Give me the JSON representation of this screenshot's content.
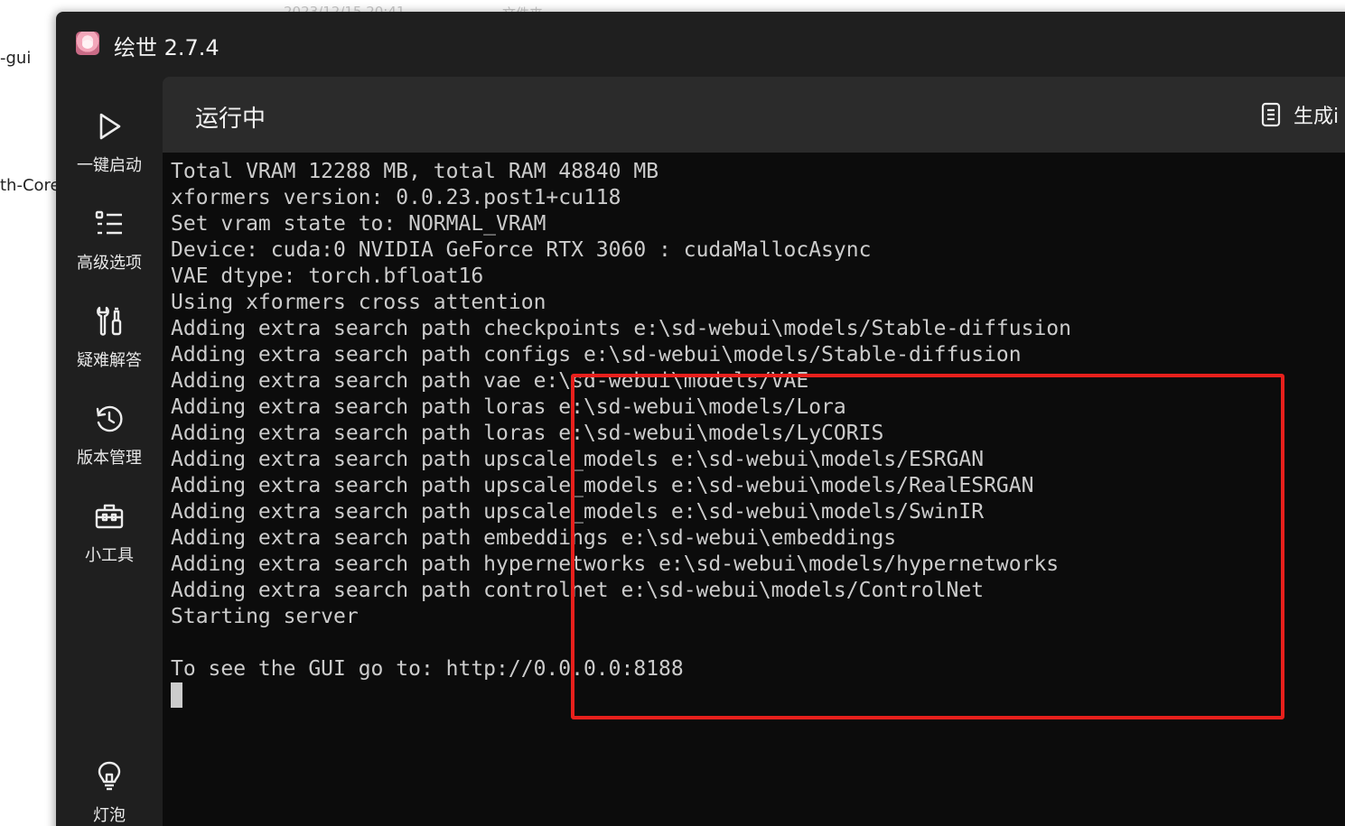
{
  "desktop": {
    "left_text_1": "-gui",
    "left_text_2": "th-Core",
    "top_text_1": "2023/12/15 20:41",
    "top_text_2": "文件夹"
  },
  "window": {
    "title": "绘世 2.7.4"
  },
  "sidebar": {
    "items": [
      {
        "label": "一键启动",
        "icon": "play-icon"
      },
      {
        "label": "高级选项",
        "icon": "list-icon"
      },
      {
        "label": "疑难解答",
        "icon": "tools-icon"
      },
      {
        "label": "版本管理",
        "icon": "history-icon"
      },
      {
        "label": "小工具",
        "icon": "toolbox-icon"
      }
    ],
    "bottom_item": {
      "label": "灯泡",
      "icon": "lightbulb-icon"
    }
  },
  "header": {
    "status": "运行中",
    "gen_button_label": "生成i",
    "gen_button_icon": "document-icon"
  },
  "terminal": {
    "lines": [
      "Total VRAM 12288 MB, total RAM 48840 MB",
      "xformers version: 0.0.23.post1+cu118",
      "Set vram state to: NORMAL_VRAM",
      "Device: cuda:0 NVIDIA GeForce RTX 3060 : cudaMallocAsync",
      "VAE dtype: torch.bfloat16",
      "Using xformers cross attention",
      "Adding extra search path checkpoints e:\\sd-webui\\models/Stable-diffusion",
      "Adding extra search path configs e:\\sd-webui\\models/Stable-diffusion",
      "Adding extra search path vae e:\\sd-webui\\models/VAE",
      "Adding extra search path loras e:\\sd-webui\\models/Lora",
      "Adding extra search path loras e:\\sd-webui\\models/LyCORIS",
      "Adding extra search path upscale_models e:\\sd-webui\\models/ESRGAN",
      "Adding extra search path upscale_models e:\\sd-webui\\models/RealESRGAN",
      "Adding extra search path upscale_models e:\\sd-webui\\models/SwinIR",
      "Adding extra search path embeddings e:\\sd-webui\\embeddings",
      "Adding extra search path hypernetworks e:\\sd-webui\\models/hypernetworks",
      "Adding extra search path controlnet e:\\sd-webui\\models/ControlNet",
      "Starting server",
      "",
      "To see the GUI go to: http://0.0.0.0:8188"
    ]
  },
  "colors": {
    "highlight_box": "#e8201c",
    "terminal_bg": "#0c0c0c",
    "terminal_text": "#cccccc",
    "sidebar_bg": "#1f1f1f",
    "header_bg": "#2b2b2b"
  }
}
